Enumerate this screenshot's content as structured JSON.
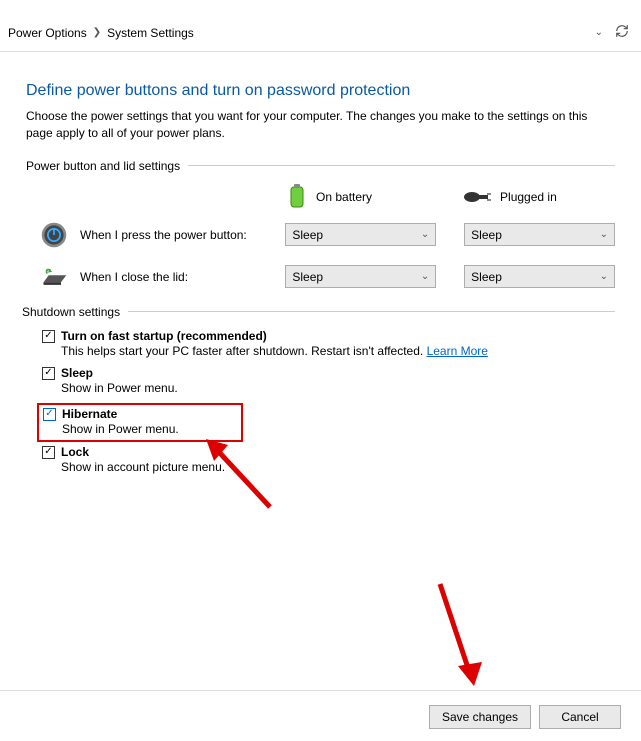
{
  "breadcrumb": {
    "parent": "Power Options",
    "current": "System Settings"
  },
  "title": "Define power buttons and turn on password protection",
  "description": "Choose the power settings that you want for your computer. The changes you make to the settings on this page apply to all of your power plans.",
  "sections": {
    "power_button": {
      "label": "Power button and lid settings",
      "col_battery": "On battery",
      "col_plugged": "Plugged in",
      "rows": [
        {
          "label": "When I press the power button:",
          "battery": "Sleep",
          "plugged": "Sleep"
        },
        {
          "label": "When I close the lid:",
          "battery": "Sleep",
          "plugged": "Sleep"
        }
      ]
    },
    "shutdown": {
      "label": "Shutdown settings",
      "items": [
        {
          "label": "Turn on fast startup (recommended)",
          "desc": "This helps start your PC faster after shutdown. Restart isn't affected.",
          "link": "Learn More",
          "checked": true
        },
        {
          "label": "Sleep",
          "desc": "Show in Power menu.",
          "checked": true
        },
        {
          "label": "Hibernate",
          "desc": "Show in Power menu.",
          "checked": true,
          "highlighted": true
        },
        {
          "label": "Lock",
          "desc": "Show in account picture menu.",
          "checked": true
        }
      ]
    }
  },
  "buttons": {
    "save": "Save changes",
    "cancel": "Cancel"
  }
}
